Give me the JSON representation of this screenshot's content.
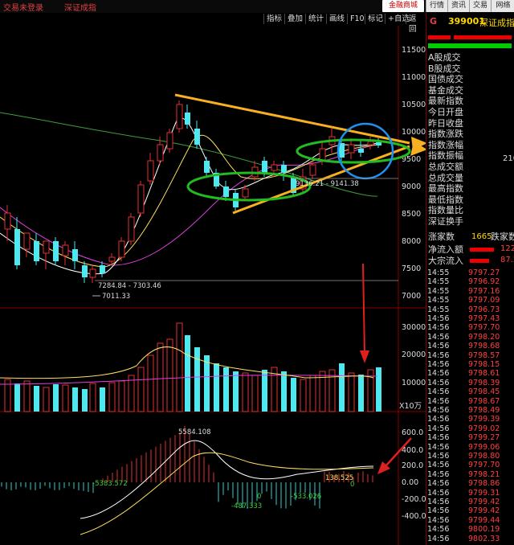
{
  "topbar": {
    "status": "交易未登录",
    "app_title": "深证成指",
    "shop": "金融商城",
    "buttons": [
      "行情",
      "资讯",
      "交易",
      "网络"
    ]
  },
  "toolbar": {
    "items": [
      "指标",
      "叠加",
      "统计",
      "画线",
      "F10",
      "标记",
      "+自选",
      "返回"
    ]
  },
  "side": {
    "market_letter": "G",
    "code": "399001",
    "name": "深证成指",
    "labels": [
      "A股成交",
      "B股成交",
      "国债成交",
      "基金成交",
      "最新指数",
      "今日开盘",
      "昨日收盘",
      "指数涨跌",
      "指数涨幅",
      "指数振幅",
      "总成交额",
      "总成交量",
      "最高指数",
      "最低指数",
      "指数量比",
      "深证换手"
    ],
    "partial_value": "210",
    "rise_label": "涨家数",
    "rise_value": "1665",
    "fall_label": "跌家数",
    "inflow_label": "净流入额",
    "inflow_value": "122",
    "big_label": "大宗流入",
    "big_value": "87.2",
    "ticks": [
      {
        "time": "14:55",
        "price": "9797.27"
      },
      {
        "time": "14:55",
        "price": "9796.92"
      },
      {
        "time": "14:55",
        "price": "9797.16"
      },
      {
        "time": "14:55",
        "price": "9797.09"
      },
      {
        "time": "14:55",
        "price": "9796.73"
      },
      {
        "time": "14:56",
        "price": "9797.43"
      },
      {
        "time": "14:56",
        "price": "9797.70"
      },
      {
        "time": "14:56",
        "price": "9798.20"
      },
      {
        "time": "14:56",
        "price": "9798.68"
      },
      {
        "time": "14:56",
        "price": "9798.57"
      },
      {
        "time": "14:56",
        "price": "9798.15"
      },
      {
        "time": "14:56",
        "price": "9798.61"
      },
      {
        "time": "14:56",
        "price": "9798.39"
      },
      {
        "time": "14:56",
        "price": "9798.45"
      },
      {
        "time": "14:56",
        "price": "9798.67"
      },
      {
        "time": "14:56",
        "price": "9798.49"
      },
      {
        "time": "14:56",
        "price": "9799.39"
      },
      {
        "time": "14:56",
        "price": "9799.02"
      },
      {
        "time": "14:56",
        "price": "9799.27"
      },
      {
        "time": "14:56",
        "price": "9799.06"
      },
      {
        "time": "14:56",
        "price": "9798.80"
      },
      {
        "time": "14:56",
        "price": "9797.70"
      },
      {
        "time": "14:56",
        "price": "9798.21"
      },
      {
        "time": "14:56",
        "price": "9798.86"
      },
      {
        "time": "14:56",
        "price": "9799.31"
      },
      {
        "time": "14:56",
        "price": "9799.42"
      },
      {
        "time": "14:56",
        "price": "9799.42"
      },
      {
        "time": "14:56",
        "price": "9799.44"
      },
      {
        "time": "14:56",
        "price": "9800.19"
      },
      {
        "time": "14:56",
        "price": "9802.33"
      }
    ]
  },
  "colors": {
    "up": "#e23030",
    "down": "#4de8f0",
    "ma_white": "#ffffff",
    "ma_yellow": "#ffe060",
    "ma_magenta": "#e040e0",
    "ma_green": "#3ca03c",
    "arrow_orange": "#f8b020",
    "circle_blue": "#2090f0"
  },
  "price_panel": {
    "axis": [
      "11500",
      "11000",
      "10500",
      "10000",
      "9500",
      "9000",
      "8500",
      "8000",
      "7500",
      "7000"
    ],
    "label_range": "7284.84 - 7303.46",
    "label_low": "7011.33",
    "label_mid": "9136.21 - 9141.38"
  },
  "volume_panel": {
    "axis": [
      "30000",
      "20000",
      "10000"
    ],
    "unit": "X10万"
  },
  "macd_panel": {
    "axis": [
      "600.0",
      "400.0",
      "200.0",
      "0.00",
      "-200.0",
      "-400.0"
    ],
    "annotations": [
      "5584.108",
      "-5383.572",
      "-487.333",
      "-533.026",
      "138.525",
      "0",
      "0"
    ]
  }
}
